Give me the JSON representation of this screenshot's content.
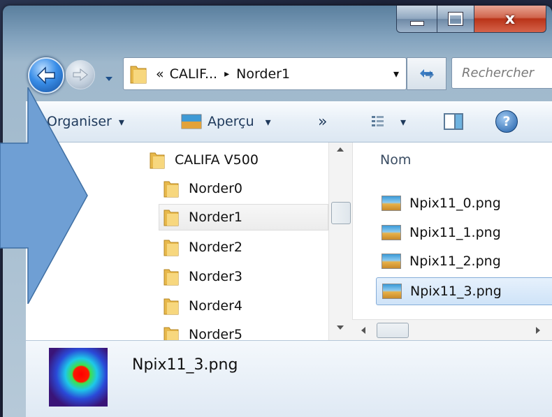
{
  "window": {
    "caption": {
      "close_glyph": "x"
    }
  },
  "address": {
    "overflow": "«",
    "path_parent": "CALIF...",
    "separator": "▸",
    "path_current": "Norder1",
    "dropdown": "▾"
  },
  "search": {
    "placeholder": "Rechercher"
  },
  "toolbar": {
    "organise_label": "Organiser",
    "organise_arrow": "▾",
    "preview_label": "Aperçu",
    "preview_arrow": "▾",
    "more": "»",
    "view_arrow": "▾",
    "help": "?"
  },
  "tree": {
    "items": [
      {
        "label": "CALIFA V500",
        "selected": false
      },
      {
        "label": "Norder0",
        "selected": false
      },
      {
        "label": "Norder1",
        "selected": true
      },
      {
        "label": "Norder2",
        "selected": false
      },
      {
        "label": "Norder3",
        "selected": false
      },
      {
        "label": "Norder4",
        "selected": false
      },
      {
        "label": "Norder5",
        "selected": false
      }
    ]
  },
  "files": {
    "column_name": "Nom",
    "items": [
      {
        "name": "Npix11_0.png",
        "selected": false
      },
      {
        "name": "Npix11_1.png",
        "selected": false
      },
      {
        "name": "Npix11_2.png",
        "selected": false
      },
      {
        "name": "Npix11_3.png",
        "selected": true
      }
    ]
  },
  "details": {
    "file_name": "Npix11_3.png"
  },
  "colors": {
    "overlay_arrow": "#6f9fd4",
    "overlay_arrow_border": "#3f6fa3",
    "selection_fill": "#cfe3f8",
    "close_red": "#c8452c"
  }
}
